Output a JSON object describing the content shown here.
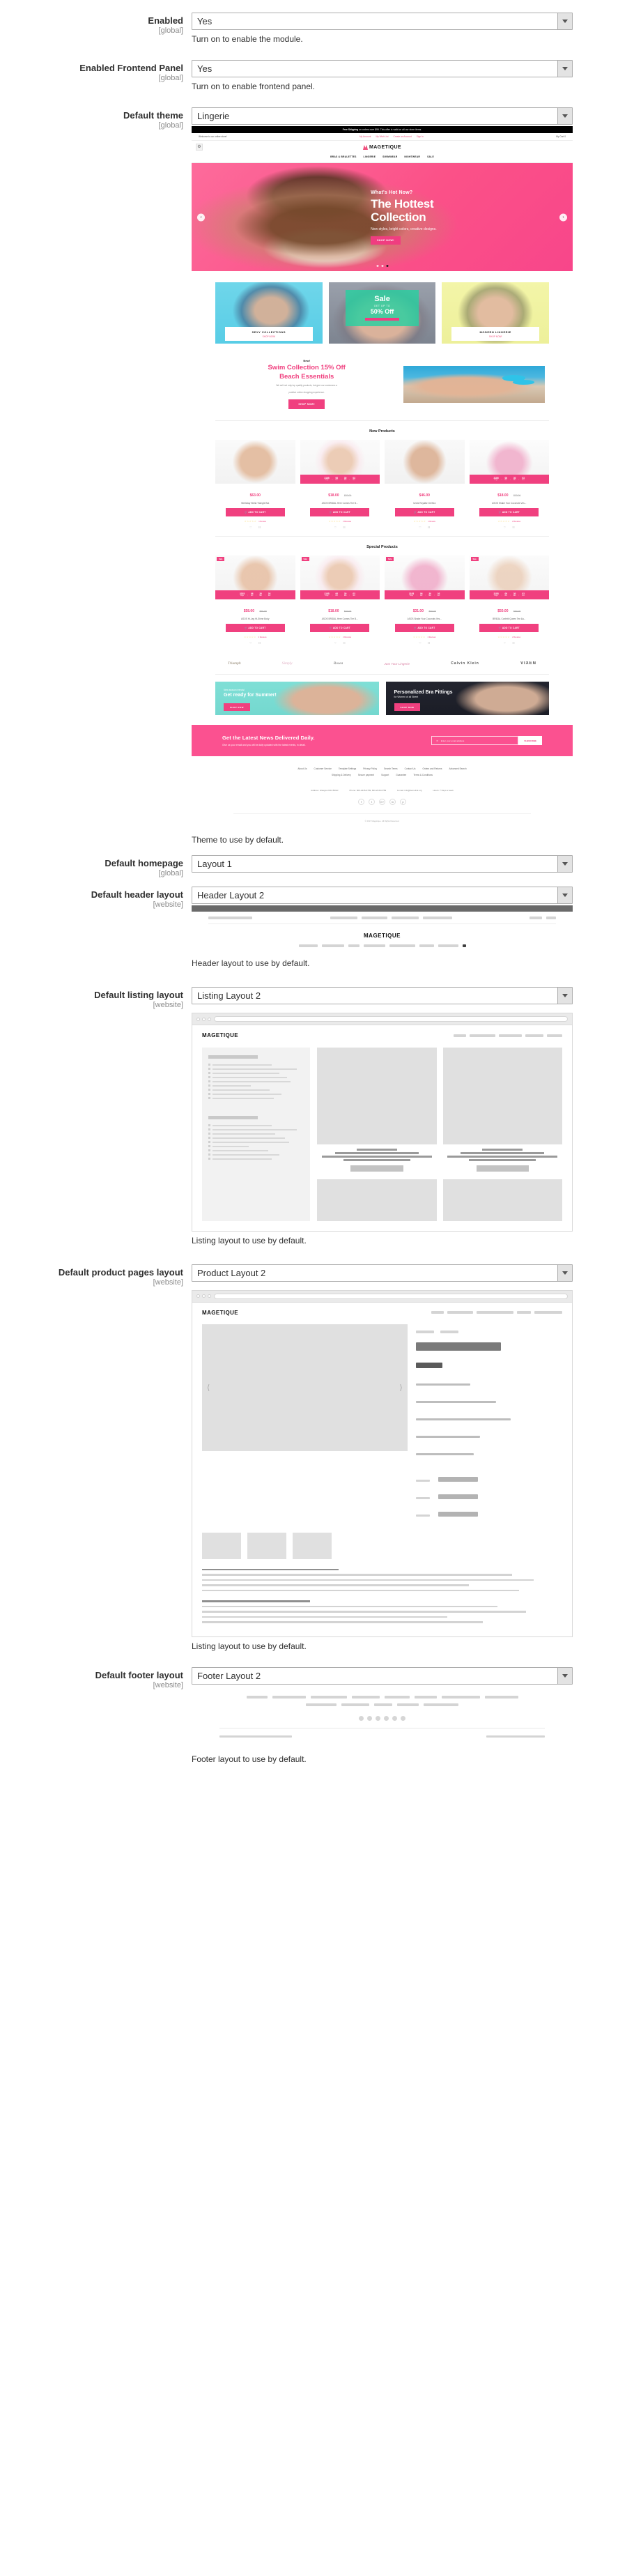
{
  "fields": {
    "enabled": {
      "label": "Enabled",
      "scope": "[global]",
      "value": "Yes",
      "note": "Turn on to enable the module."
    },
    "frontend_panel": {
      "label": "Enabled Frontend Panel",
      "scope": "[global]",
      "value": "Yes",
      "note": "Turn on to enable frontend panel."
    },
    "default_theme": {
      "label": "Default theme",
      "scope": "[global]",
      "value": "Lingerie",
      "note": "Theme to use by default."
    },
    "default_homepage": {
      "label": "Default homepage",
      "scope": "[global]",
      "value": "Layout 1"
    },
    "default_header_layout": {
      "label": "Default header layout",
      "scope": "[website]",
      "value": "Header Layout 2",
      "note": "Header layout to use by default."
    },
    "default_listing_layout": {
      "label": "Default listing layout",
      "scope": "[website]",
      "value": "Listing Layout 2",
      "note": "Listing layout to use by default."
    },
    "default_product_pages_layout": {
      "label": "Default product pages layout",
      "scope": "[website]",
      "value": "Product Layout 2",
      "note": "Listing layout to use by default."
    },
    "default_footer_layout": {
      "label": "Default footer layout",
      "scope": "[website]",
      "value": "Footer Layout 2",
      "note": "Footer layout to use by default."
    }
  },
  "theme_preview": {
    "topbar": {
      "strong": "Free Shipping",
      "rest": "on orders over $99. This offer is valid on all our store items."
    },
    "welcome": "Welcome to our online store!",
    "account_links": [
      "My Account",
      "My Wish List",
      "Create an Account",
      "Sign In"
    ],
    "cart_label": "My Cart",
    "cart_count": "0",
    "logo": "MAGETIQUE",
    "nav": [
      "BRAS & BRALETTES",
      "LINGERIE",
      "SWIMWEAR",
      "NIGHTWEAR",
      "SALE"
    ],
    "hero": {
      "kicker": "What's Hot Now?",
      "title_line1": "The Hottest",
      "title_line2": "Collection",
      "subtitle": "New styles, bright colors, creative designs.",
      "button": "SHOP NOW!"
    },
    "tiles": [
      {
        "name": "SEXY COLLECTIONS",
        "link": "SHOP NOW!"
      },
      {
        "name": "",
        "link": "",
        "sale_title": "Sale",
        "sale_kicker": "GET UP TO",
        "sale_amount": "50% Off"
      },
      {
        "name": "MODERN LINGERIE",
        "link": "SHOP NOW!"
      }
    ],
    "swim": {
      "kicker": "New!",
      "title_line1": "Swim Collection 15% Off",
      "title_line2": "Beach Essentials",
      "desc_line1": "We sell not only top quality products, but give our customers a",
      "desc_line2": "positive online shopping experience.",
      "button": "SHOP NOW!"
    },
    "new_products": {
      "title": "New Products",
      "items": [
        {
          "price": "$63.00",
          "old_price": "",
          "name": "Weekday Stella Triangle Bra",
          "button": "ADD TO CART",
          "reviews": "1 Review",
          "timer": null
        },
        {
          "price": "$18.00",
          "old_price": "$22.00",
          "name": "ASOS BRIDAL Here Comes The B...",
          "button": "ADD TO CART",
          "reviews": "2 Reviews",
          "timer": {
            "days": "3185",
            "hrs": "06",
            "min": "30",
            "sec": "03"
          }
        },
        {
          "price": "$46.00",
          "old_price": "",
          "name": "Undiz Royalitz Gel Bra",
          "button": "ADD TO CART",
          "reviews": "1 Review",
          "timer": null
        },
        {
          "price": "$18.00",
          "old_price": "$22.00",
          "name": "ASOS Shake Your Coconuts Ves...",
          "button": "ADD TO CART",
          "reviews": "2 Reviews",
          "timer": {
            "days": "3185",
            "hrs": "06",
            "min": "30",
            "sec": "03"
          }
        }
      ]
    },
    "special_products": {
      "title": "Special Products",
      "flag": "Sale",
      "items": [
        {
          "price": "$58.00",
          "old_price": "$65.00",
          "name": "ASOS Hi-Leg Hi-Shine Body",
          "button": "ADD TO CART",
          "reviews": "2 Reviews",
          "timer": {
            "days": "3185",
            "hrs": "06",
            "min": "30",
            "sec": "03"
          }
        },
        {
          "price": "$18.00",
          "old_price": "$22.00",
          "name": "ASOS BRIDAL Here Comes The B...",
          "button": "ADD TO CART",
          "reviews": "2 Reviews",
          "timer": {
            "days": "3185",
            "hrs": "06",
            "min": "30",
            "sec": "03"
          }
        },
        {
          "price": "$31.00",
          "old_price": "$36.00",
          "name": "ASOS Shake Your Coconuts Ves...",
          "button": "ADD TO CART",
          "reviews": "2 Reviews",
          "timer": {
            "days": "3185",
            "hrs": "06",
            "min": "30",
            "sec": "03"
          }
        },
        {
          "price": "$50.00",
          "old_price": "$54.00",
          "name": "BRIDAL Confetti Queen Tee &a...",
          "button": "ADD TO CART",
          "reviews": "2 Reviews",
          "timer": {
            "days": "3185",
            "hrs": "06",
            "min": "30",
            "sec": "03"
          }
        }
      ]
    },
    "brands": [
      "Triumph",
      "Simply",
      "Rosea",
      "Just Your Lingerie",
      "Calvin Klein",
      "VIXEN"
    ],
    "bottom_banners": [
      {
        "kicker": "New season trends!",
        "title": "Get ready for Summer!",
        "button": "SHOP NOW"
      },
      {
        "kicker": "for Women of all Street",
        "title": "Personalized Bra Fittings",
        "button": "SHOP NOW"
      }
    ],
    "newsletter": {
      "title": "Get the Latest News Delivered Daily.",
      "subtitle": "Give us your email and you will be daily updated with the latest events, in detail.",
      "placeholder": "Enter your email address",
      "button": "SUBSCRIBE"
    },
    "footer": {
      "links_row1": [
        "About Us",
        "Customer Service",
        "Template Settings",
        "Privacy Policy",
        "Search Terms",
        "Contact Us",
        "Orders and Returns",
        "Advanced Search"
      ],
      "links_row2": [
        "Shipping & Delivery",
        "Secure payment",
        "Support",
        "Guarantee",
        "Terms & Conditions"
      ],
      "meta": [
        "Address: Glasgow D04 89GR",
        "Phone: 800-2345-6789, 800-2345-6789",
        "E-mail: info@demolink.org",
        "Hours: 7 Days a week"
      ],
      "social": [
        "f",
        "t",
        "G+",
        "in",
        "p"
      ],
      "copyright": "© 2017 Magetique. All Rights Reserved."
    }
  },
  "wireframes": {
    "header_logo": "MAGETIQUE",
    "listing_logo": "MAGETIQUE",
    "product_logo": "MAGETIQUE"
  }
}
